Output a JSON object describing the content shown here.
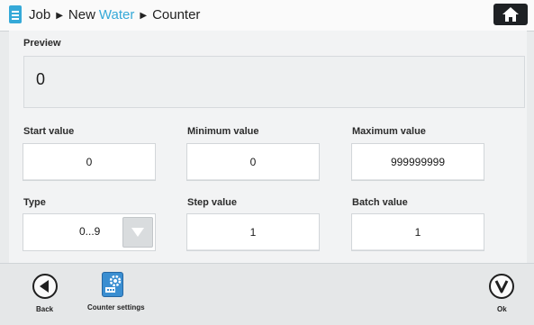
{
  "header": {
    "breadcrumb": [
      "Job",
      "New",
      "Water",
      "Counter"
    ],
    "accent_color": "#35a9d8"
  },
  "preview": {
    "label": "Preview",
    "value": "0"
  },
  "fields": {
    "start": {
      "label": "Start value",
      "value": "0"
    },
    "minimum": {
      "label": "Minimum value",
      "value": "0"
    },
    "maximum": {
      "label": "Maximum value",
      "value": "999999999"
    },
    "type": {
      "label": "Type",
      "value": "0...9"
    },
    "step": {
      "label": "Step value",
      "value": "1"
    },
    "batch": {
      "label": "Batch value",
      "value": "1"
    }
  },
  "footer": {
    "back_label": "Back",
    "counter_settings_label": "Counter settings",
    "ok_label": "Ok"
  },
  "icons": [
    "document-icon",
    "home-icon",
    "chevron-down-icon",
    "back-arrow-icon",
    "gear-icon",
    "checkmark-icon"
  ]
}
